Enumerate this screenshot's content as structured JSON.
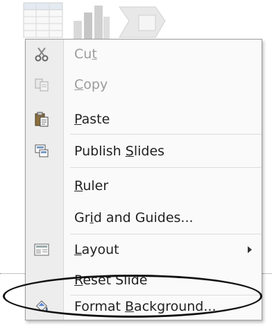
{
  "menu": {
    "items": [
      {
        "pre": "Cu",
        "key": "t",
        "post": "",
        "disabled": true,
        "icon": "scissors-icon"
      },
      {
        "pre": "",
        "key": "C",
        "post": "opy",
        "disabled": true,
        "icon": "copy-icon"
      },
      {
        "pre": "",
        "key": "P",
        "post": "aste",
        "disabled": false,
        "icon": "paste-icon"
      },
      {
        "pre": "Publish ",
        "key": "S",
        "post": "lides",
        "disabled": false,
        "icon": "publish-slides-icon"
      },
      {
        "pre": "",
        "key": "R",
        "post": "uler",
        "disabled": false,
        "icon": ""
      },
      {
        "pre": "Gr",
        "key": "i",
        "post": "d and Guides...",
        "disabled": false,
        "icon": ""
      },
      {
        "pre": "",
        "key": "L",
        "post": "ayout",
        "disabled": false,
        "icon": "layout-icon",
        "submenu": true
      },
      {
        "pre": "",
        "key": "R",
        "post": "eset Slide",
        "disabled": false,
        "icon": ""
      },
      {
        "pre": "Format ",
        "key": "B",
        "post": "ackground...",
        "disabled": false,
        "icon": "format-background-icon"
      }
    ]
  },
  "colors": {
    "menu_bg": "#fafafa",
    "gutter": "#ededed",
    "disabled_text": "#9b9b9b",
    "highlight_ellipse": "#111111"
  }
}
